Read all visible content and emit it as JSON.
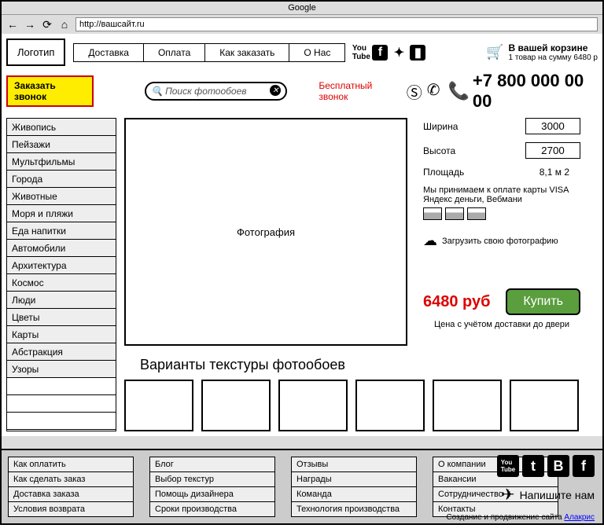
{
  "browser": {
    "title": "Google",
    "url": "http://вашсайт.ru"
  },
  "header": {
    "logo": "Логотип",
    "nav": [
      "Доставка",
      "Оплата",
      "Как заказать",
      "О Нас"
    ],
    "cart_line1": "В вашей корзине",
    "cart_line2": "1 товар на сумму 6480 р"
  },
  "row2": {
    "callback": "Заказать звонок",
    "search_placeholder": "Поиск фотообоев",
    "free_call": "Бесплатный звонок",
    "phone": "+7 800 000 00 00"
  },
  "categories": [
    "Живопись",
    "Пейзажи",
    "Мультфильмы",
    "Города",
    "Животные",
    "Моря и пляжи",
    "Еда напитки",
    "Автомобили",
    "Архитектура",
    "Космос",
    "Люди",
    "Цветы",
    "Карты",
    "Абстракция",
    "Узоры",
    "",
    "",
    ""
  ],
  "product": {
    "photo_label": "Фотография",
    "width_label": "Ширина",
    "width_value": "3000",
    "height_label": "Высота",
    "height_value": "2700",
    "area_label": "Площадь",
    "area_value": "8,1 м 2",
    "payment_note1": "Мы принимаем к оплате карты VISA",
    "payment_note2": "Яндекс деньги, Вебмани",
    "upload_label": "Загрузить свою фотографию",
    "price": "6480 руб",
    "buy": "Купить",
    "price_note": "Цена с учётом доставки до двери",
    "textures_title": "Варианты текстуры фотообоев"
  },
  "footer": {
    "col1": [
      "Как оплатить",
      "Как сделать заказ",
      "Доставка заказа",
      "Условия возврата"
    ],
    "col2": [
      "Блог",
      "Выбор текстур",
      "Помощь дизайнера",
      "Сроки производства"
    ],
    "col3": [
      "Отзывы",
      "Награды",
      "Команда",
      "Технология производства"
    ],
    "col4": [
      "О компании",
      "Вакансии",
      "Сотрудничество",
      "Контакты"
    ],
    "write_us": "Напишите нам",
    "credit_text": "Создание и продвижение сайта ",
    "credit_link": "Алакрис"
  }
}
